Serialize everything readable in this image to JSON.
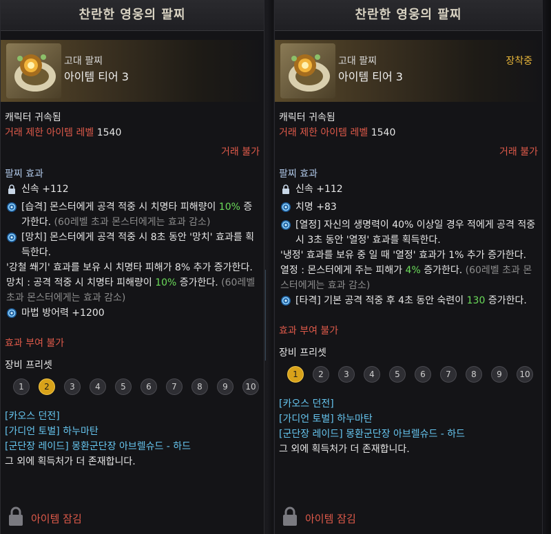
{
  "panels": [
    {
      "title": "찬란한 영웅의 팔찌",
      "grade": "고대 팔찌",
      "tier": "아이템 티어 3",
      "equipped": "",
      "bound": "캐릭터 귀속됨",
      "trade_limit_label": "거래 제한 아이템 레벨",
      "trade_limit_value": "1540",
      "trade": "거래 불가",
      "effect_title": "팔찌 효과",
      "effects": [
        {
          "icon": "lock-icon",
          "text": "신속 +112"
        },
        {
          "icon": "swirl-icon",
          "pre": "[습격] 몬스터에게 공격 적중 시 치명타 피해량이 ",
          "hl": "10%",
          "post": " 증가한다.",
          "note": " (60레벨 초과 몬스터에게는 효과 감소)"
        },
        {
          "icon": "swirl-icon",
          "pre": "[망치] 몬스터에게 공격 적중 시 8초 동안 '망치' 효과를 획득한다.",
          "hl": "",
          "post": "",
          "note": ""
        },
        {
          "icon": "",
          "pre": "'강철 쐐기' 효과를 보유 시 치명타 피해가 8% 추가 증가한다.",
          "hl": "",
          "post": "",
          "note": ""
        },
        {
          "icon": "",
          "pre": "망치 : 공격 적중 시 치명타 피해량이 ",
          "hl": "10%",
          "post": " 증가한다.",
          "note": " (60레벨 초과 몬스터에게는 효과 감소)"
        },
        {
          "icon": "swirl-icon",
          "pre": "마법 방어력 +1200",
          "hl": "",
          "post": "",
          "note": ""
        }
      ],
      "no_imbue": "효과 부여 불가",
      "preset_label": "장비 프리셋",
      "presets": [
        "1",
        "2",
        "3",
        "4",
        "5",
        "6",
        "7",
        "8",
        "9",
        "10"
      ],
      "active_preset": 1,
      "sources": [
        "[카오스 던전]",
        "[가디언 토벌] 하누마탄",
        "[군단장 레이드] 몽환군단장 아브렐슈드 - 하드"
      ],
      "more": "그 외에 획득처가 더 존재합니다.",
      "lock_label": "아이템 잠김"
    },
    {
      "title": "찬란한 영웅의 팔찌",
      "grade": "고대 팔찌",
      "tier": "아이템 티어 3",
      "equipped": "장착중",
      "bound": "캐릭터 귀속됨",
      "trade_limit_label": "거래 제한 아이템 레벨",
      "trade_limit_value": "1540",
      "trade": "거래 불가",
      "effect_title": "팔찌 효과",
      "effects": [
        {
          "icon": "lock-icon",
          "text": "신속 +112"
        },
        {
          "icon": "swirl-icon",
          "text": "치명 +83"
        },
        {
          "icon": "swirl-icon",
          "pre": "[열정] 자신의 생명력이 40% 이상일 경우 적에게 공격 적중 시 3초 동안 '열정' 효과를 획득한다.",
          "hl": "",
          "post": "",
          "note": ""
        },
        {
          "icon": "",
          "pre": "'냉정' 효과를 보유 중 일 때 '열정' 효과가 1% 추가 증가한다.",
          "hl": "",
          "post": "",
          "note": ""
        },
        {
          "icon": "",
          "pre": "열정 : 몬스터에게 주는 피해가 ",
          "hl": "4%",
          "post": " 증가한다.",
          "note": " (60레벨 초과 몬스터에게는 효과 감소)"
        },
        {
          "icon": "swirl-icon",
          "pre": "[타격] 기본 공격 적중 후 4초 동안 숙련이 ",
          "hl": "130",
          "post": " 증가한다.",
          "note": ""
        }
      ],
      "no_imbue": "효과 부여 불가",
      "preset_label": "장비 프리셋",
      "presets": [
        "1",
        "2",
        "3",
        "4",
        "5",
        "6",
        "7",
        "8",
        "9",
        "10"
      ],
      "active_preset": 0,
      "sources": [
        "[카오스 던전]",
        "[가디언 토벌] 하누마탄",
        "[군단장 레이드] 몽환군단장 아브렐슈드 - 하드"
      ],
      "more": "그 외에 획득처가 더 존재합니다.",
      "lock_label": "아이템 잠김"
    }
  ],
  "colors": {
    "accent_gold": "#e8b63a",
    "warn_red": "#e05a4a",
    "highlight_green": "#6bdc5a",
    "link_cyan": "#66c6f0"
  }
}
